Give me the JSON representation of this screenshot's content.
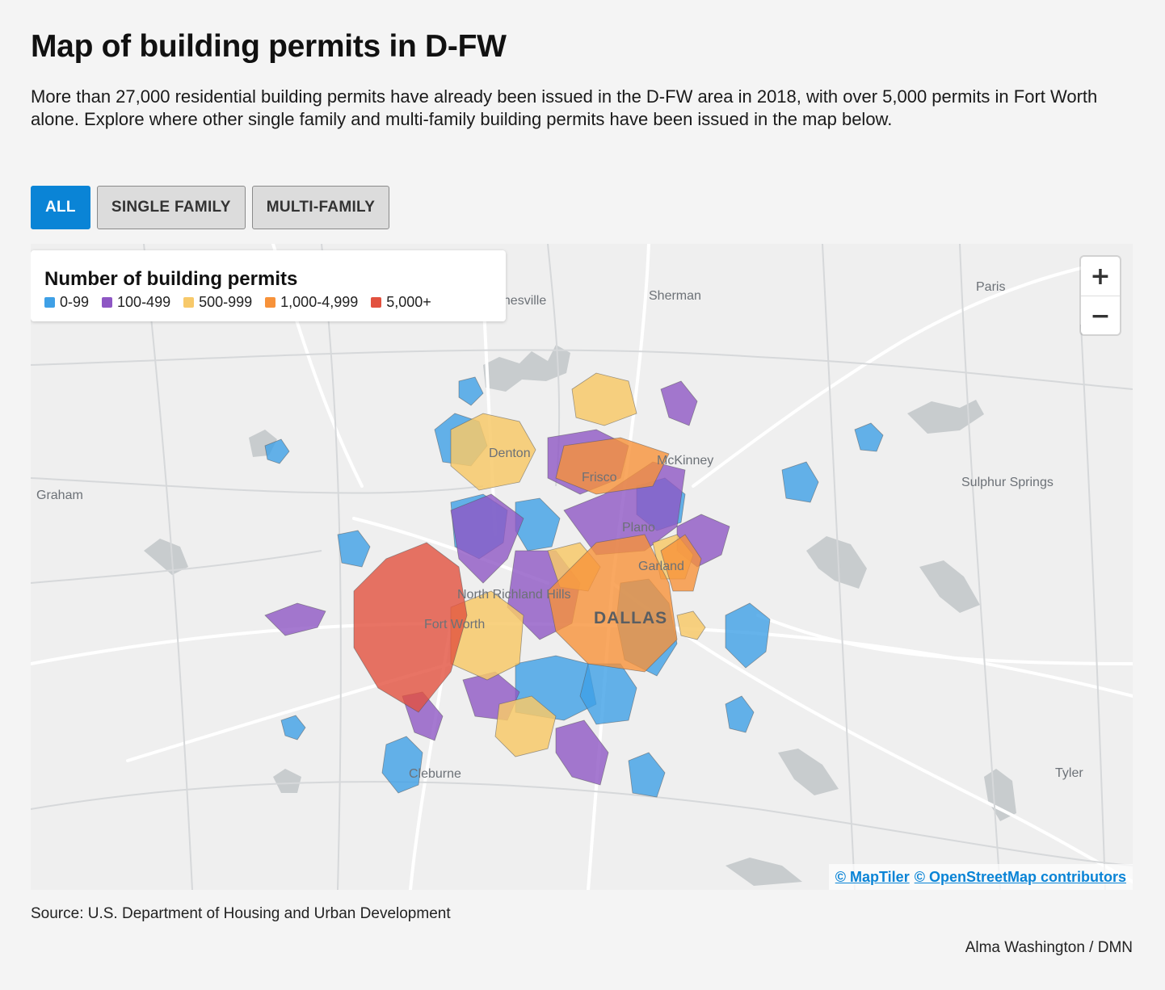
{
  "title": "Map of building permits in D-FW",
  "description": "More than 27,000 residential building permits have already been issued in the D-FW area in 2018, with over 5,000 permits in Fort Worth alone. Explore where other single family and multi-family building permits have been issued in the map below.",
  "filters": [
    {
      "label": "ALL",
      "active": true
    },
    {
      "label": "SINGLE FAMILY",
      "active": false
    },
    {
      "label": "MULTI-FAMILY",
      "active": false
    }
  ],
  "legend": {
    "title": "Number of building permits",
    "items": [
      {
        "label": "0-99",
        "color": "#3fa0e6"
      },
      {
        "label": "100-499",
        "color": "#8e57c4"
      },
      {
        "label": "500-999",
        "color": "#f7c96a"
      },
      {
        "label": "1,000-4,999",
        "color": "#f7923a"
      },
      {
        "label": "5,000+",
        "color": "#e2513f"
      }
    ]
  },
  "map": {
    "places": [
      "Gainesville",
      "Sherman",
      "Paris",
      "Denton",
      "Frisco",
      "McKinney",
      "Graham",
      "Sulphur Springs",
      "Plano",
      "Garland",
      "North Richland Hills",
      "Fort Worth",
      "DALLAS",
      "Cleburne",
      "Tyler"
    ],
    "zoom_in": "+",
    "zoom_out": "−",
    "attribution": [
      "© MapTiler",
      "© OpenStreetMap contributors"
    ]
  },
  "source": "Source: U.S. Department of Housing and Urban Development",
  "credit": "Alma Washington / DMN"
}
